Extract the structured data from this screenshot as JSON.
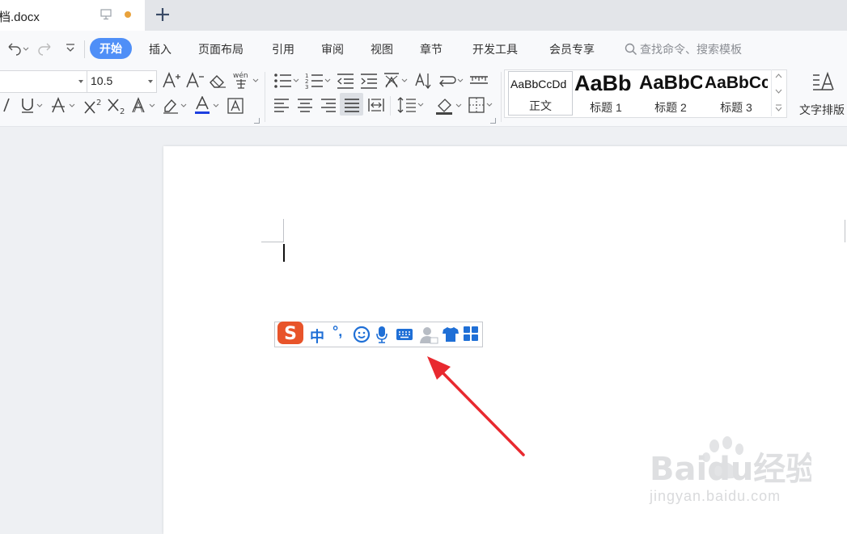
{
  "tab": {
    "title": "档.docx",
    "unsaved_dot_color": "#e9a23b"
  },
  "menu": {
    "items": [
      "开始",
      "插入",
      "页面布局",
      "引用",
      "审阅",
      "视图",
      "章节",
      "开发工具",
      "会员专享"
    ],
    "active": "开始",
    "search_placeholder": "查找命令、搜索模板"
  },
  "ribbon": {
    "font_size": "10.5",
    "styles": [
      {
        "sample": "AaBbCcDd",
        "label": "正文"
      },
      {
        "sample": "AaBb",
        "label": "标题 1"
      },
      {
        "sample": "AaBbC",
        "label": "标题 2"
      },
      {
        "sample": "AaBbCc",
        "label": "标题 3"
      }
    ],
    "text_layout_label": "文字排版"
  },
  "ime": {
    "chinese_mode": "中",
    "punctuation": "°,",
    "icons": [
      "emoji-icon",
      "microphone-icon",
      "keyboard-icon",
      "user-icon",
      "skin-icon",
      "apps-grid-icon"
    ],
    "brand_color": "#e8542a",
    "icon_color": "#1f6fd6"
  },
  "annotation": {
    "arrow_color": "#e8292f"
  },
  "watermark": {
    "brand": "Baidu经验",
    "domain": "jingyan.baidu.com"
  },
  "accent_color": "#4f8ff7"
}
